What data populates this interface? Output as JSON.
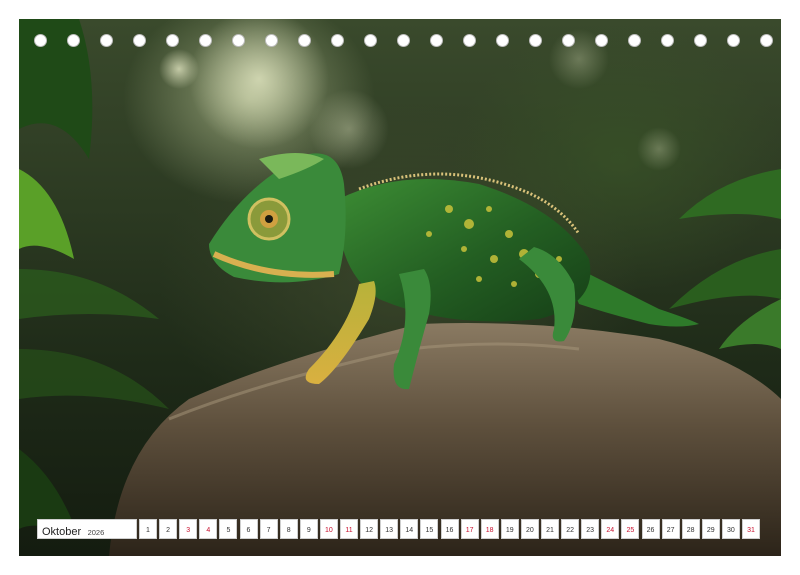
{
  "calendar": {
    "month": "Oktober",
    "year": "2026",
    "days": [
      {
        "num": "1",
        "red": false
      },
      {
        "num": "2",
        "red": false
      },
      {
        "num": "3",
        "red": true
      },
      {
        "num": "4",
        "red": true
      },
      {
        "num": "5",
        "red": false
      },
      {
        "num": "6",
        "red": false
      },
      {
        "num": "7",
        "red": false
      },
      {
        "num": "8",
        "red": false
      },
      {
        "num": "9",
        "red": false
      },
      {
        "num": "10",
        "red": true
      },
      {
        "num": "11",
        "red": true
      },
      {
        "num": "12",
        "red": false
      },
      {
        "num": "13",
        "red": false
      },
      {
        "num": "14",
        "red": false
      },
      {
        "num": "15",
        "red": false
      },
      {
        "num": "16",
        "red": false
      },
      {
        "num": "17",
        "red": true
      },
      {
        "num": "18",
        "red": true
      },
      {
        "num": "19",
        "red": false
      },
      {
        "num": "20",
        "red": false
      },
      {
        "num": "21",
        "red": false
      },
      {
        "num": "22",
        "red": false
      },
      {
        "num": "23",
        "red": false
      },
      {
        "num": "24",
        "red": true
      },
      {
        "num": "25",
        "red": true
      },
      {
        "num": "26",
        "red": false
      },
      {
        "num": "27",
        "red": false
      },
      {
        "num": "28",
        "red": false
      },
      {
        "num": "29",
        "red": false
      },
      {
        "num": "30",
        "red": false
      },
      {
        "num": "31",
        "red": true
      }
    ],
    "weekend_color": "#c8102e"
  },
  "photo": {
    "subject": "chameleon-on-rock",
    "colors": {
      "chameleon": "#2f7a2a",
      "spots": "#c8c23a",
      "rock": "#6b5a44",
      "foliage": "#2a5a1c"
    }
  },
  "binding_holes": 23
}
